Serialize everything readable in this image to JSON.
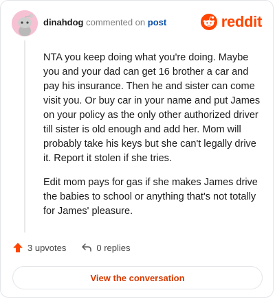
{
  "header": {
    "username": "dinahdog",
    "action": "commented on",
    "post_link": "post"
  },
  "logo": {
    "text": "reddit",
    "icon": "reddit-snoo-icon",
    "color": "#ff4500"
  },
  "comment": {
    "paragraphs": [
      "NTA you keep doing what you're doing. Maybe you and your dad can get 16 brother a car and pay his insurance. Then he and sister can come visit you. Or buy car in your name and put James on your policy as the only other authorized driver till sister is old enough and add her. Mom will probably take his keys but she can't legally drive it. Report it stolen if she tries.",
      "Edit mom pays for gas if she makes James drive the babies to school or anything that's not totally for James' pleasure."
    ]
  },
  "actions": {
    "upvotes": "3 upvotes",
    "replies": "0 replies",
    "upvote_icon": "upvote-arrow-icon",
    "reply_icon": "reply-icon",
    "upvote_color": "#ff4500"
  },
  "view_button": {
    "label": "View the conversation",
    "color": "#d93a00"
  }
}
